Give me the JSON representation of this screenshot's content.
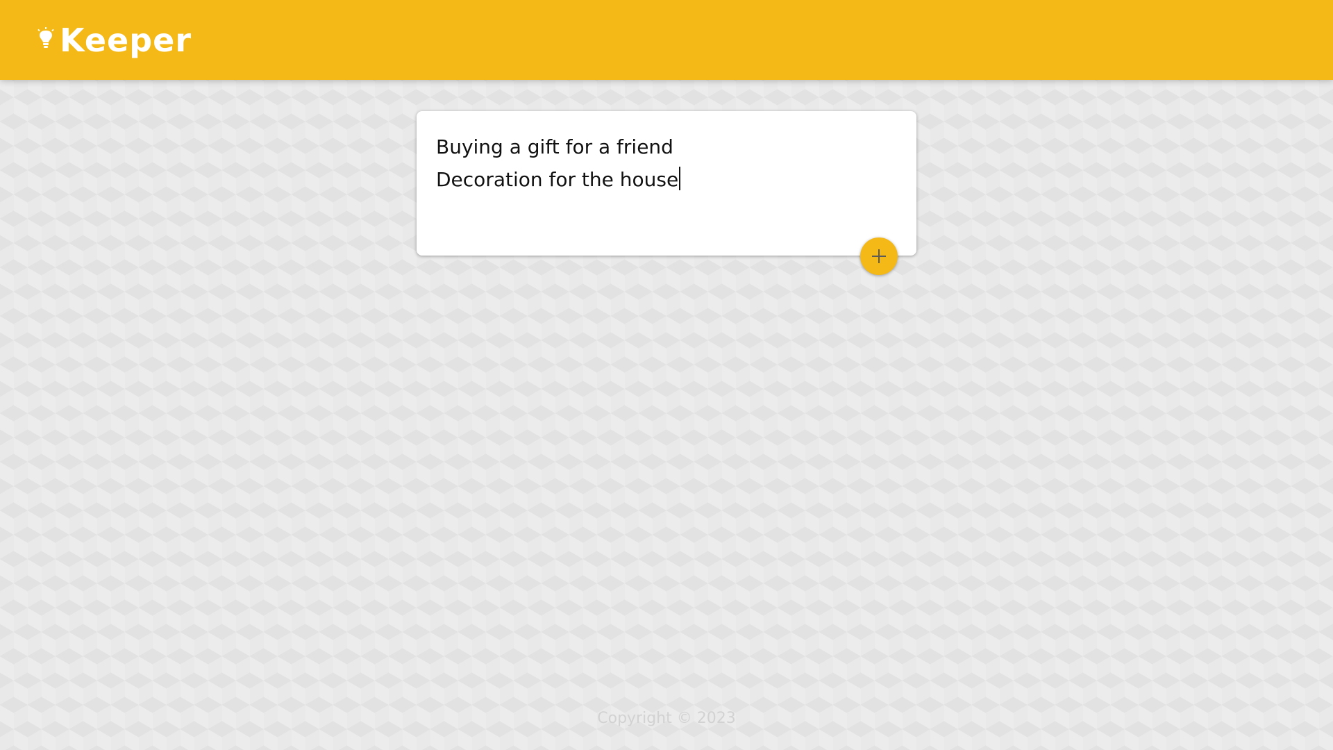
{
  "app": {
    "title": "Keeper",
    "icon": "lightbulb-icon"
  },
  "note_form": {
    "lines": [
      "Buying a gift for a friend",
      "Decoration for the house"
    ]
  },
  "add_button": {
    "icon": "plus-icon"
  },
  "footer": {
    "copyright": "Copyright © 2023"
  },
  "colors": {
    "brand": "#f4b916",
    "card": "#ffffff",
    "text": "#111111",
    "footer_text": "#d2d2d2"
  }
}
